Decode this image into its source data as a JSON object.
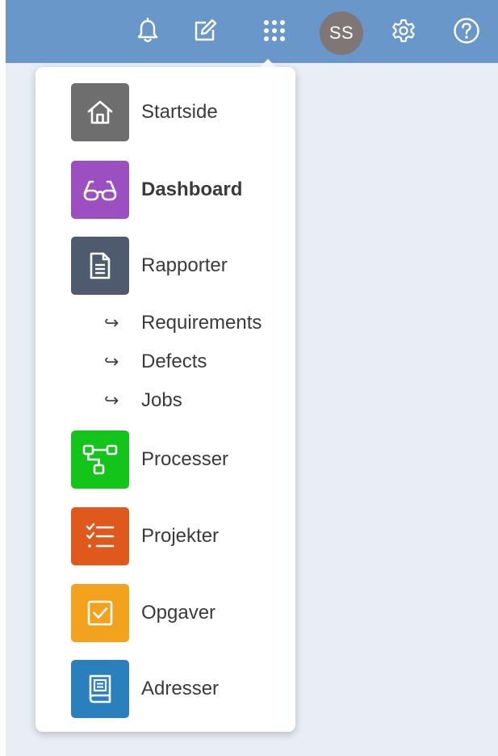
{
  "topbar": {
    "bell_icon": "bell-icon",
    "edit_icon": "edit-icon",
    "apps_icon": "apps-grid-icon",
    "avatar_initials": "SS",
    "settings_icon": "gear-icon",
    "help_icon": "help-icon",
    "color": "#6a97c9"
  },
  "menu": {
    "items": [
      {
        "label": "Startside",
        "icon": "home-icon",
        "color": "#6e6e6e"
      },
      {
        "label": "Dashboard",
        "icon": "glasses-icon",
        "color": "#9b4fc0"
      },
      {
        "label": "Rapporter",
        "icon": "document-icon",
        "color": "#4e5b6e"
      },
      {
        "label": "Processer",
        "icon": "process-flow-icon",
        "color": "#13c41a"
      },
      {
        "label": "Projekter",
        "icon": "checklist-icon",
        "color": "#e0591c"
      },
      {
        "label": "Opgaver",
        "icon": "checkbox-icon",
        "color": "#f2a21d"
      },
      {
        "label": "Adresser",
        "icon": "address-book-icon",
        "color": "#2a7fbd"
      }
    ],
    "sub_items": [
      {
        "arrow": "↪",
        "label": "Requirements"
      },
      {
        "arrow": "↪",
        "label": "Defects"
      },
      {
        "arrow": "↪",
        "label": "Jobs"
      }
    ]
  }
}
